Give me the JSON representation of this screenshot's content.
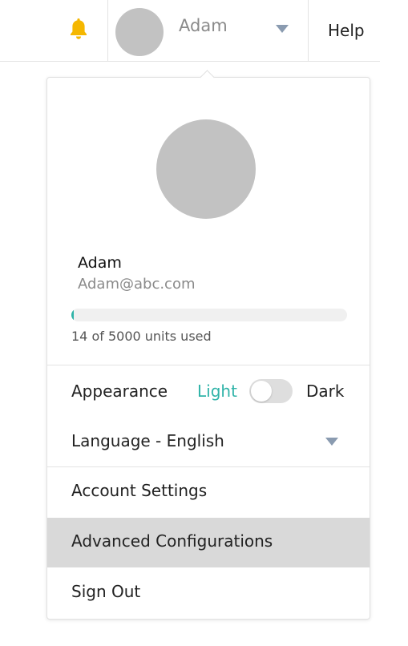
{
  "header": {
    "user_name": "Adam",
    "help_label": "Help",
    "bell_color": "#f5b700"
  },
  "profile": {
    "name": "Adam",
    "email": "Adam@abc.com",
    "usage_fraction": 0.0028,
    "usage_text": "14 of 5000 units used"
  },
  "appearance": {
    "label": "Appearance",
    "light_label": "Light",
    "dark_label": "Dark",
    "selected": "Light"
  },
  "language": {
    "label": "Language - English"
  },
  "menu": {
    "account_settings": "Account Settings",
    "advanced_configurations": "Advanced Configurations",
    "sign_out": "Sign Out"
  },
  "colors": {
    "accent": "#2fb3a8",
    "highlight": "#d9d9d9"
  },
  "icons": {
    "notification": "bell-icon",
    "dropdown": "chevron-down-icon"
  }
}
